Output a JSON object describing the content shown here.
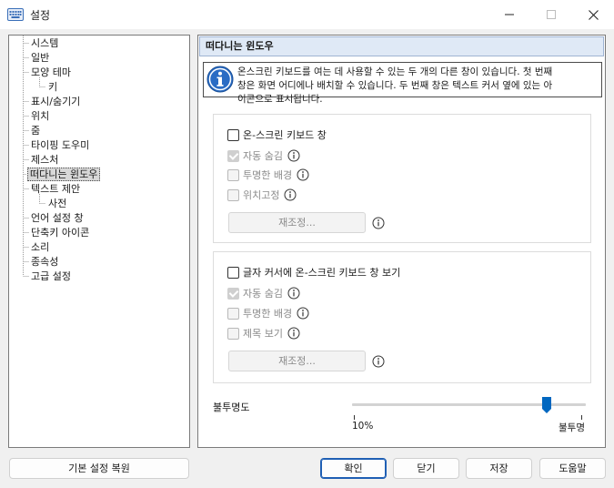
{
  "window": {
    "title": "설정",
    "icon": "keyboard-icon",
    "controls": [
      "minimize-icon",
      "maximize-icon",
      "close-icon"
    ]
  },
  "tree": {
    "items": [
      {
        "label": "시스템",
        "level": 1
      },
      {
        "label": "일반",
        "level": 1
      },
      {
        "label": "모양 테마",
        "level": 1
      },
      {
        "label": "키",
        "level": 2
      },
      {
        "label": "표시/숨기기",
        "level": 1
      },
      {
        "label": "위치",
        "level": 1
      },
      {
        "label": "줌",
        "level": 1
      },
      {
        "label": "타이핑 도우미",
        "level": 1
      },
      {
        "label": "제스처",
        "level": 1
      },
      {
        "label": "떠다니는 윈도우",
        "level": 1,
        "selected": true
      },
      {
        "label": "텍스트 제안",
        "level": 1
      },
      {
        "label": "사전",
        "level": 2
      },
      {
        "label": "언어 설정 창",
        "level": 1
      },
      {
        "label": "단축키 아이콘",
        "level": 1
      },
      {
        "label": "소리",
        "level": 1
      },
      {
        "label": "종속성",
        "level": 1
      },
      {
        "label": "고급 설정",
        "level": 1
      }
    ]
  },
  "panel": {
    "title": "떠다니는 윈도우",
    "info_icon": "info-icon",
    "info_line1": "온스크린 키보드를 여는 데 사용할 수 있는 두 개의 다른 창이 있습니다. 첫 번째",
    "info_line2": "창은 화면 어디에나 배치할 수 있습니다. 두 번째 창은 텍스트 커서 옆에 있는 아",
    "info_line3": "이콘으로 표시됩니다.",
    "group1": {
      "main_label": "온-스크린 키보드 창",
      "auto_hide": "자동 숨김",
      "transparent_bg": "투명한 배경",
      "fixed_pos": "위치고정",
      "reset": "재조정..."
    },
    "group2": {
      "main_label": "글자 커서에 온-스크린 키보드 창 보기",
      "auto_hide": "자동 숨김",
      "transparent_bg": "투명한 배경",
      "show_title": "제목 보기",
      "reset": "재조정..."
    },
    "opacity": {
      "label": "불투명도",
      "min_label": "10%",
      "max_label": "불투명",
      "min": 10,
      "max": 100,
      "value": 85
    }
  },
  "buttons": {
    "restore_defaults": "기본 설정 복원",
    "ok": "확인",
    "close": "닫기",
    "save": "저장",
    "help": "도움말"
  },
  "colors": {
    "accent": "#0067c0",
    "header_bg": "#dfe9f6",
    "info_blue": "#2a6cc4"
  }
}
